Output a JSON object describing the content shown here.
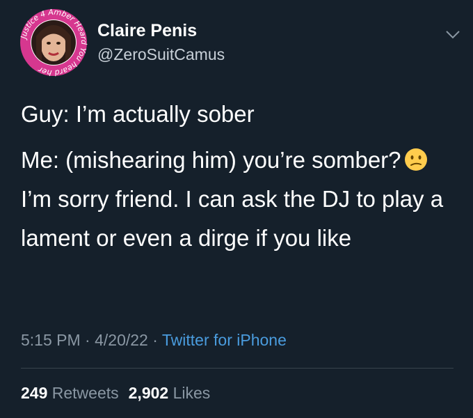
{
  "author": {
    "display_name": "Claire Penis",
    "handle": "@ZeroSuitCamus",
    "avatar_ring_text": "Justice 4 Amber Heard You heard her"
  },
  "tweet": {
    "line1": "Guy: I’m actually sober",
    "line2_part1": "Me: (mishearing him) you’re somber?",
    "line2_part2": "I’m sorry friend. I can ask the DJ to play a lament or even a dirge if you like",
    "emoji": "confused-face-icon"
  },
  "meta": {
    "time": "5:15 PM",
    "sep1": "·",
    "date": "4/20/22",
    "sep2": "·",
    "source": "Twitter for iPhone"
  },
  "stats": {
    "retweets_count": "249",
    "retweets_label": "Retweets",
    "likes_count": "2,902",
    "likes_label": "Likes"
  },
  "colors": {
    "background": "#15202b",
    "link": "#4a9cde",
    "secondary_text": "#8a97a3",
    "avatar_ring": "#d6378f"
  }
}
